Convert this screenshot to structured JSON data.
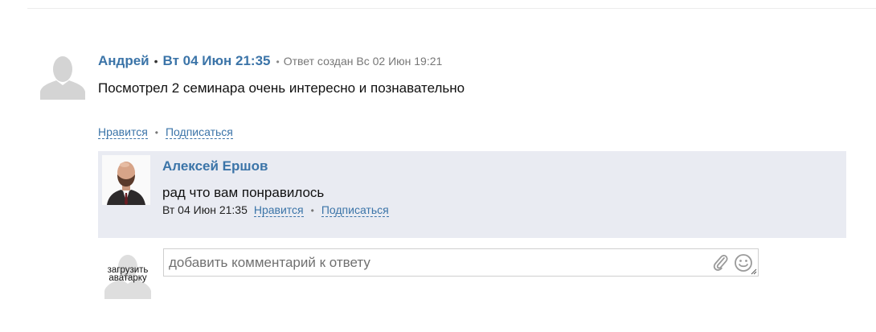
{
  "comment": {
    "author": "Андрей",
    "separator": "•",
    "date": "Вт 04 Июн 21:35",
    "created_separator": "•",
    "created_text": "Ответ создан Вс 02 Июн 19:21",
    "text": "Посмотрел 2 семинара очень интересно и познавательно",
    "actions": {
      "like": "Нравится",
      "subscribe": "Подписаться",
      "separator": "•"
    }
  },
  "reply": {
    "author": "Алексей Ершов",
    "text": "рад что вам понравилось",
    "date": "Вт 04 Июн 21:35",
    "actions": {
      "like": "Нравится",
      "subscribe": "Подписаться",
      "separator": "•"
    }
  },
  "composer": {
    "upload_avatar_label": "загрузить аватарку",
    "placeholder": "добавить комментарий к ответу",
    "icons": [
      "paperclip-icon",
      "smile-icon",
      "resize-handle-icon"
    ]
  },
  "colors": {
    "link": "#3b74a8",
    "reply_background": "#e9ebf2",
    "placeholder_avatar": "#d4d4d4"
  }
}
